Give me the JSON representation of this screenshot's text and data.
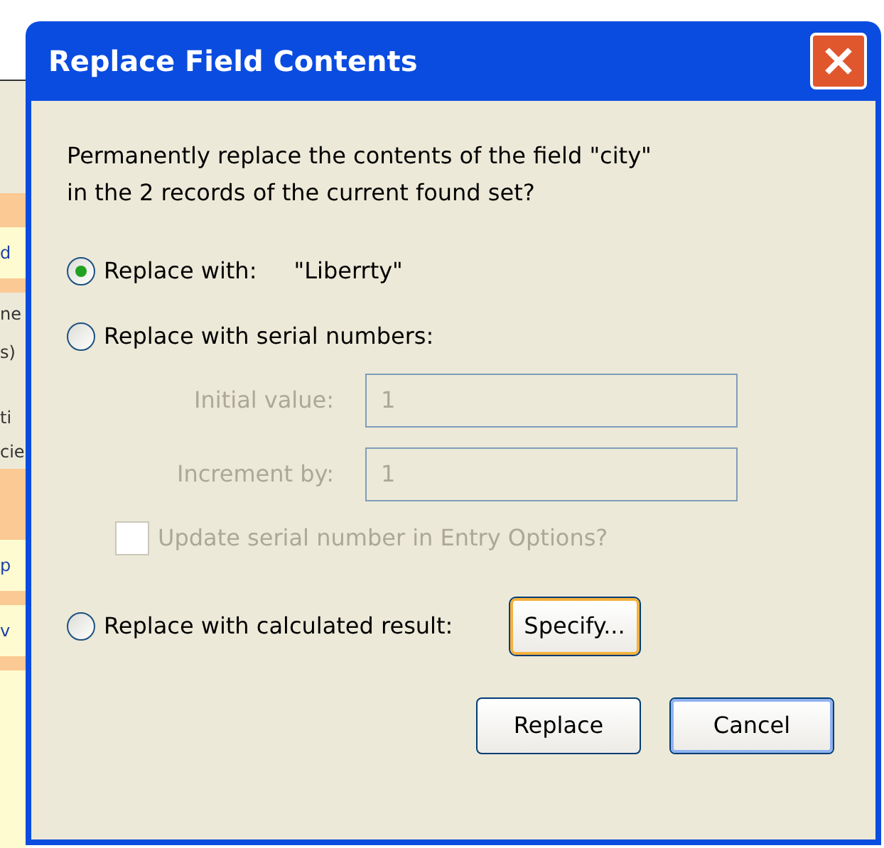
{
  "background_fragments": [
    {
      "text": "d",
      "kind": "field"
    },
    {
      "text": "ne",
      "kind": "label"
    },
    {
      "text": "s)",
      "kind": "label"
    },
    {
      "text": "ti",
      "kind": "label"
    },
    {
      "text": "cie",
      "kind": "label"
    },
    {
      "text": "p",
      "kind": "field"
    },
    {
      "text": "v",
      "kind": "field"
    }
  ],
  "window": {
    "title": "Replace Field Contents"
  },
  "message": "Permanently replace the contents of the field \"city\" in the 2 records of the current found set?",
  "options": [
    {
      "label": "Replace with:",
      "value": "\"Liberrty\"",
      "selected": true
    },
    {
      "label": "Replace with serial numbers:",
      "selected": false
    },
    {
      "label": "Replace with calculated result:",
      "selected": false
    }
  ],
  "serial": {
    "fields": [
      {
        "label": "Initial value:",
        "value": "1",
        "disabled": true
      },
      {
        "label": "Increment by:",
        "value": "1",
        "disabled": true
      }
    ],
    "update_option": {
      "label": "Update serial number in Entry Options?",
      "checked": false,
      "disabled": true
    }
  },
  "specify_button": "Specify...",
  "buttons": [
    {
      "label": "Replace",
      "default": false
    },
    {
      "label": "Cancel",
      "default": true
    }
  ]
}
